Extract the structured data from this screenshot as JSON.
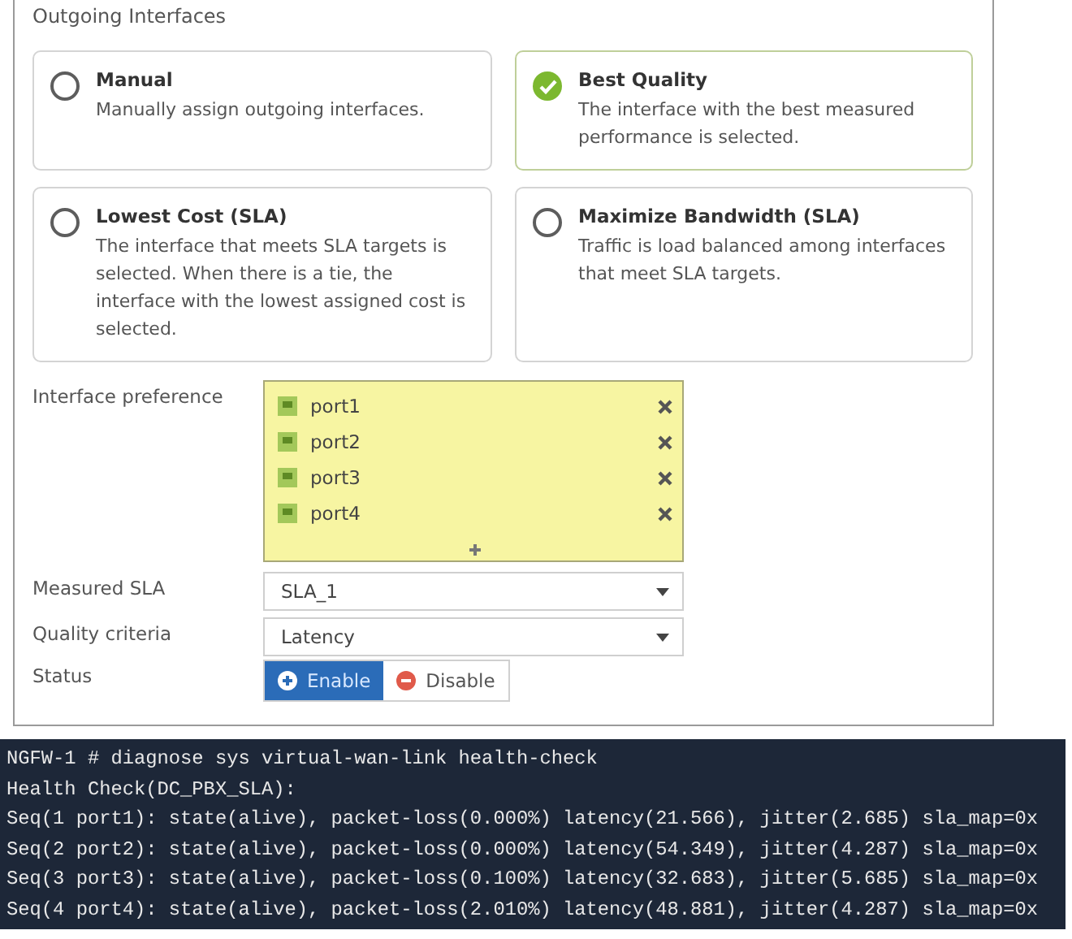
{
  "section_title": "Outgoing Interfaces",
  "strategies": [
    {
      "title": "Manual",
      "description": "Manually assign outgoing interfaces.",
      "selected": false
    },
    {
      "title": "Best Quality",
      "description": "The interface with the best measured performance is selected.",
      "selected": true
    },
    {
      "title": "Lowest Cost (SLA)",
      "description": "The interface that meets SLA targets is selected. When there is a tie, the interface with the lowest assigned cost is selected.",
      "selected": false
    },
    {
      "title": "Maximize Bandwidth (SLA)",
      "description": "Traffic is load balanced among interfaces that meet SLA targets.",
      "selected": false
    }
  ],
  "interface_preference": {
    "label": "Interface preference",
    "items": [
      "port1",
      "port2",
      "port3",
      "port4"
    ]
  },
  "measured_sla": {
    "label": "Measured SLA",
    "value": "SLA_1"
  },
  "quality_criteria": {
    "label": "Quality criteria",
    "value": "Latency"
  },
  "status": {
    "label": "Status",
    "options": [
      {
        "label": "Enable",
        "selected": true
      },
      {
        "label": "Disable",
        "selected": false
      }
    ]
  },
  "terminal": {
    "lines": [
      "NGFW-1 # diagnose sys virtual-wan-link health-check",
      "Health Check(DC_PBX_SLA):",
      "Seq(1 port1): state(alive), packet-loss(0.000%) latency(21.566), jitter(2.685) sla_map=0x",
      "Seq(2 port2): state(alive), packet-loss(0.000%) latency(54.349), jitter(4.287) sla_map=0x",
      "Seq(3 port3): state(alive), packet-loss(0.100%) latency(32.683), jitter(5.685) sla_map=0x",
      "Seq(4 port4): state(alive), packet-loss(2.010%) latency(48.881), jitter(4.287) sla_map=0x"
    ]
  }
}
